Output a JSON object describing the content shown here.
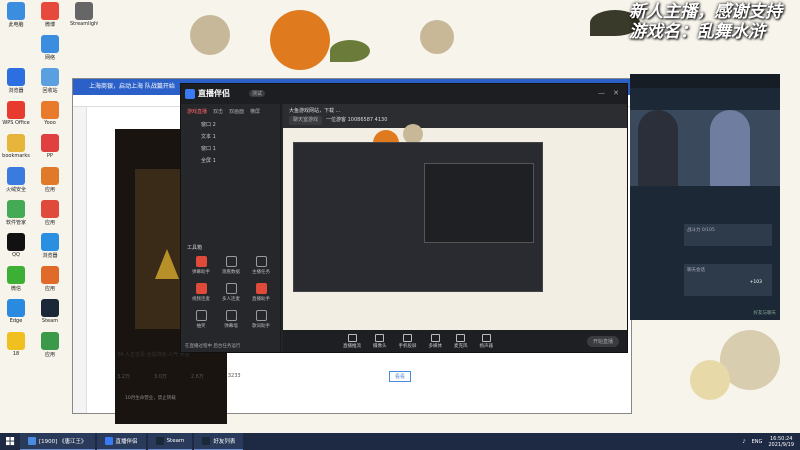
{
  "overlay": {
    "line1": "新人主播，感谢支持",
    "line2": "游戏名：乱舞水浒"
  },
  "desktop_icons": [
    {
      "label": "此电脑",
      "icon": "computer-icon",
      "color": "#3b8de0"
    },
    {
      "label": "微博",
      "icon": "weibo-icon",
      "color": "#e64a3c"
    },
    {
      "label": "Streamlight Manager",
      "icon": "user-app-icon",
      "color": "#666"
    },
    {
      "label": "网络",
      "icon": "network-icon",
      "color": "#3b8de0"
    },
    {
      "label": "浏览器",
      "icon": "browser-icon",
      "color": "#2d6ee0"
    },
    {
      "label": "回收站",
      "icon": "recycle-icon",
      "color": "#5aa0e0"
    },
    {
      "label": "WPS Office",
      "icon": "wps-icon",
      "color": "#e63b2e"
    },
    {
      "label": "Yooo",
      "icon": "app-icon",
      "color": "#e87a2b"
    },
    {
      "label": "bookmarks",
      "icon": "folder-icon",
      "color": "#e6b53a"
    },
    {
      "label": "PP",
      "icon": "app-icon",
      "color": "#e04040"
    },
    {
      "label": "火绒安全",
      "icon": "shield-icon",
      "color": "#3a7be0"
    },
    {
      "label": "应用",
      "icon": "app-icon",
      "color": "#e07a2a"
    },
    {
      "label": "软件管家",
      "icon": "store-icon",
      "color": "#44aa55"
    },
    {
      "label": "应用",
      "icon": "app-icon",
      "color": "#e04a3a"
    },
    {
      "label": "QQ",
      "icon": "qq-icon",
      "color": "#111"
    },
    {
      "label": "浏览器",
      "icon": "browser-icon",
      "color": "#2a8fe0"
    },
    {
      "label": "微信",
      "icon": "wechat-icon",
      "color": "#3cb034"
    },
    {
      "label": "应用",
      "icon": "app-icon",
      "color": "#e06a2a"
    },
    {
      "label": "Edge",
      "icon": "browser-icon",
      "color": "#2a8ae0"
    },
    {
      "label": "Steam",
      "icon": "steam-icon",
      "color": "#1b2838"
    },
    {
      "label": "18",
      "icon": "app-icon",
      "color": "#f0c020"
    },
    {
      "label": "应用",
      "icon": "app-icon",
      "color": "#3a9a4a"
    }
  ],
  "browser": {
    "title": "上海商银，启动上海 队战篇开始",
    "video_caption": "34 人正在看·全站排名·人气 大唐",
    "stats": [
      "3.2万",
      "3.0万",
      "2.6万",
      "3233"
    ],
    "footer_hint": "10月生命营业，禁止转载",
    "button": "看看"
  },
  "app": {
    "name": "直播伴侣",
    "badge": "测试",
    "tabs": [
      "游戏直播",
      "双击",
      "双画面",
      "横屏"
    ],
    "scenes": [
      "窗口 2",
      "文本 1",
      "窗口 1",
      "全屏 1"
    ],
    "stream_title": "大鱼游戏网站，下载 ...",
    "info_pill": "聊天室游戏",
    "info_online": "一位游客",
    "info_id": "10086587",
    "info_views": "4130",
    "tool_header": "工具箱",
    "tools": [
      "弹幕助手",
      "观看数据",
      "主播任务",
      "视频连麦",
      "多人连麦",
      "直播助手",
      "抽奖",
      "弹幕墙",
      "歌词助手"
    ],
    "notice": "在直播过程中 后台任务运行",
    "bottom_tools": [
      "直播推流",
      "摄像头",
      "手机投屏",
      "多媒体",
      "麦克风",
      "扬声器"
    ],
    "go_live": "开始直播"
  },
  "steam": {
    "card1": "战斗力 0/105",
    "card2": "聊天会话",
    "badge": "+103",
    "footer": "好友与聊天"
  },
  "taskbar": {
    "items": [
      {
        "label": "[1900] 《唐江王》",
        "icon": "browser-icon",
        "color": "#4a8ae0"
      },
      {
        "label": "直播伴侣",
        "icon": "app-icon",
        "color": "#3a7bf4"
      },
      {
        "label": "Steam",
        "icon": "steam-icon",
        "color": "#1b2838"
      },
      {
        "label": "好友列表",
        "icon": "steam-icon",
        "color": "#1b2838"
      }
    ],
    "lang": "ENG",
    "time": "16:50:24",
    "date": "2021/9/19"
  }
}
